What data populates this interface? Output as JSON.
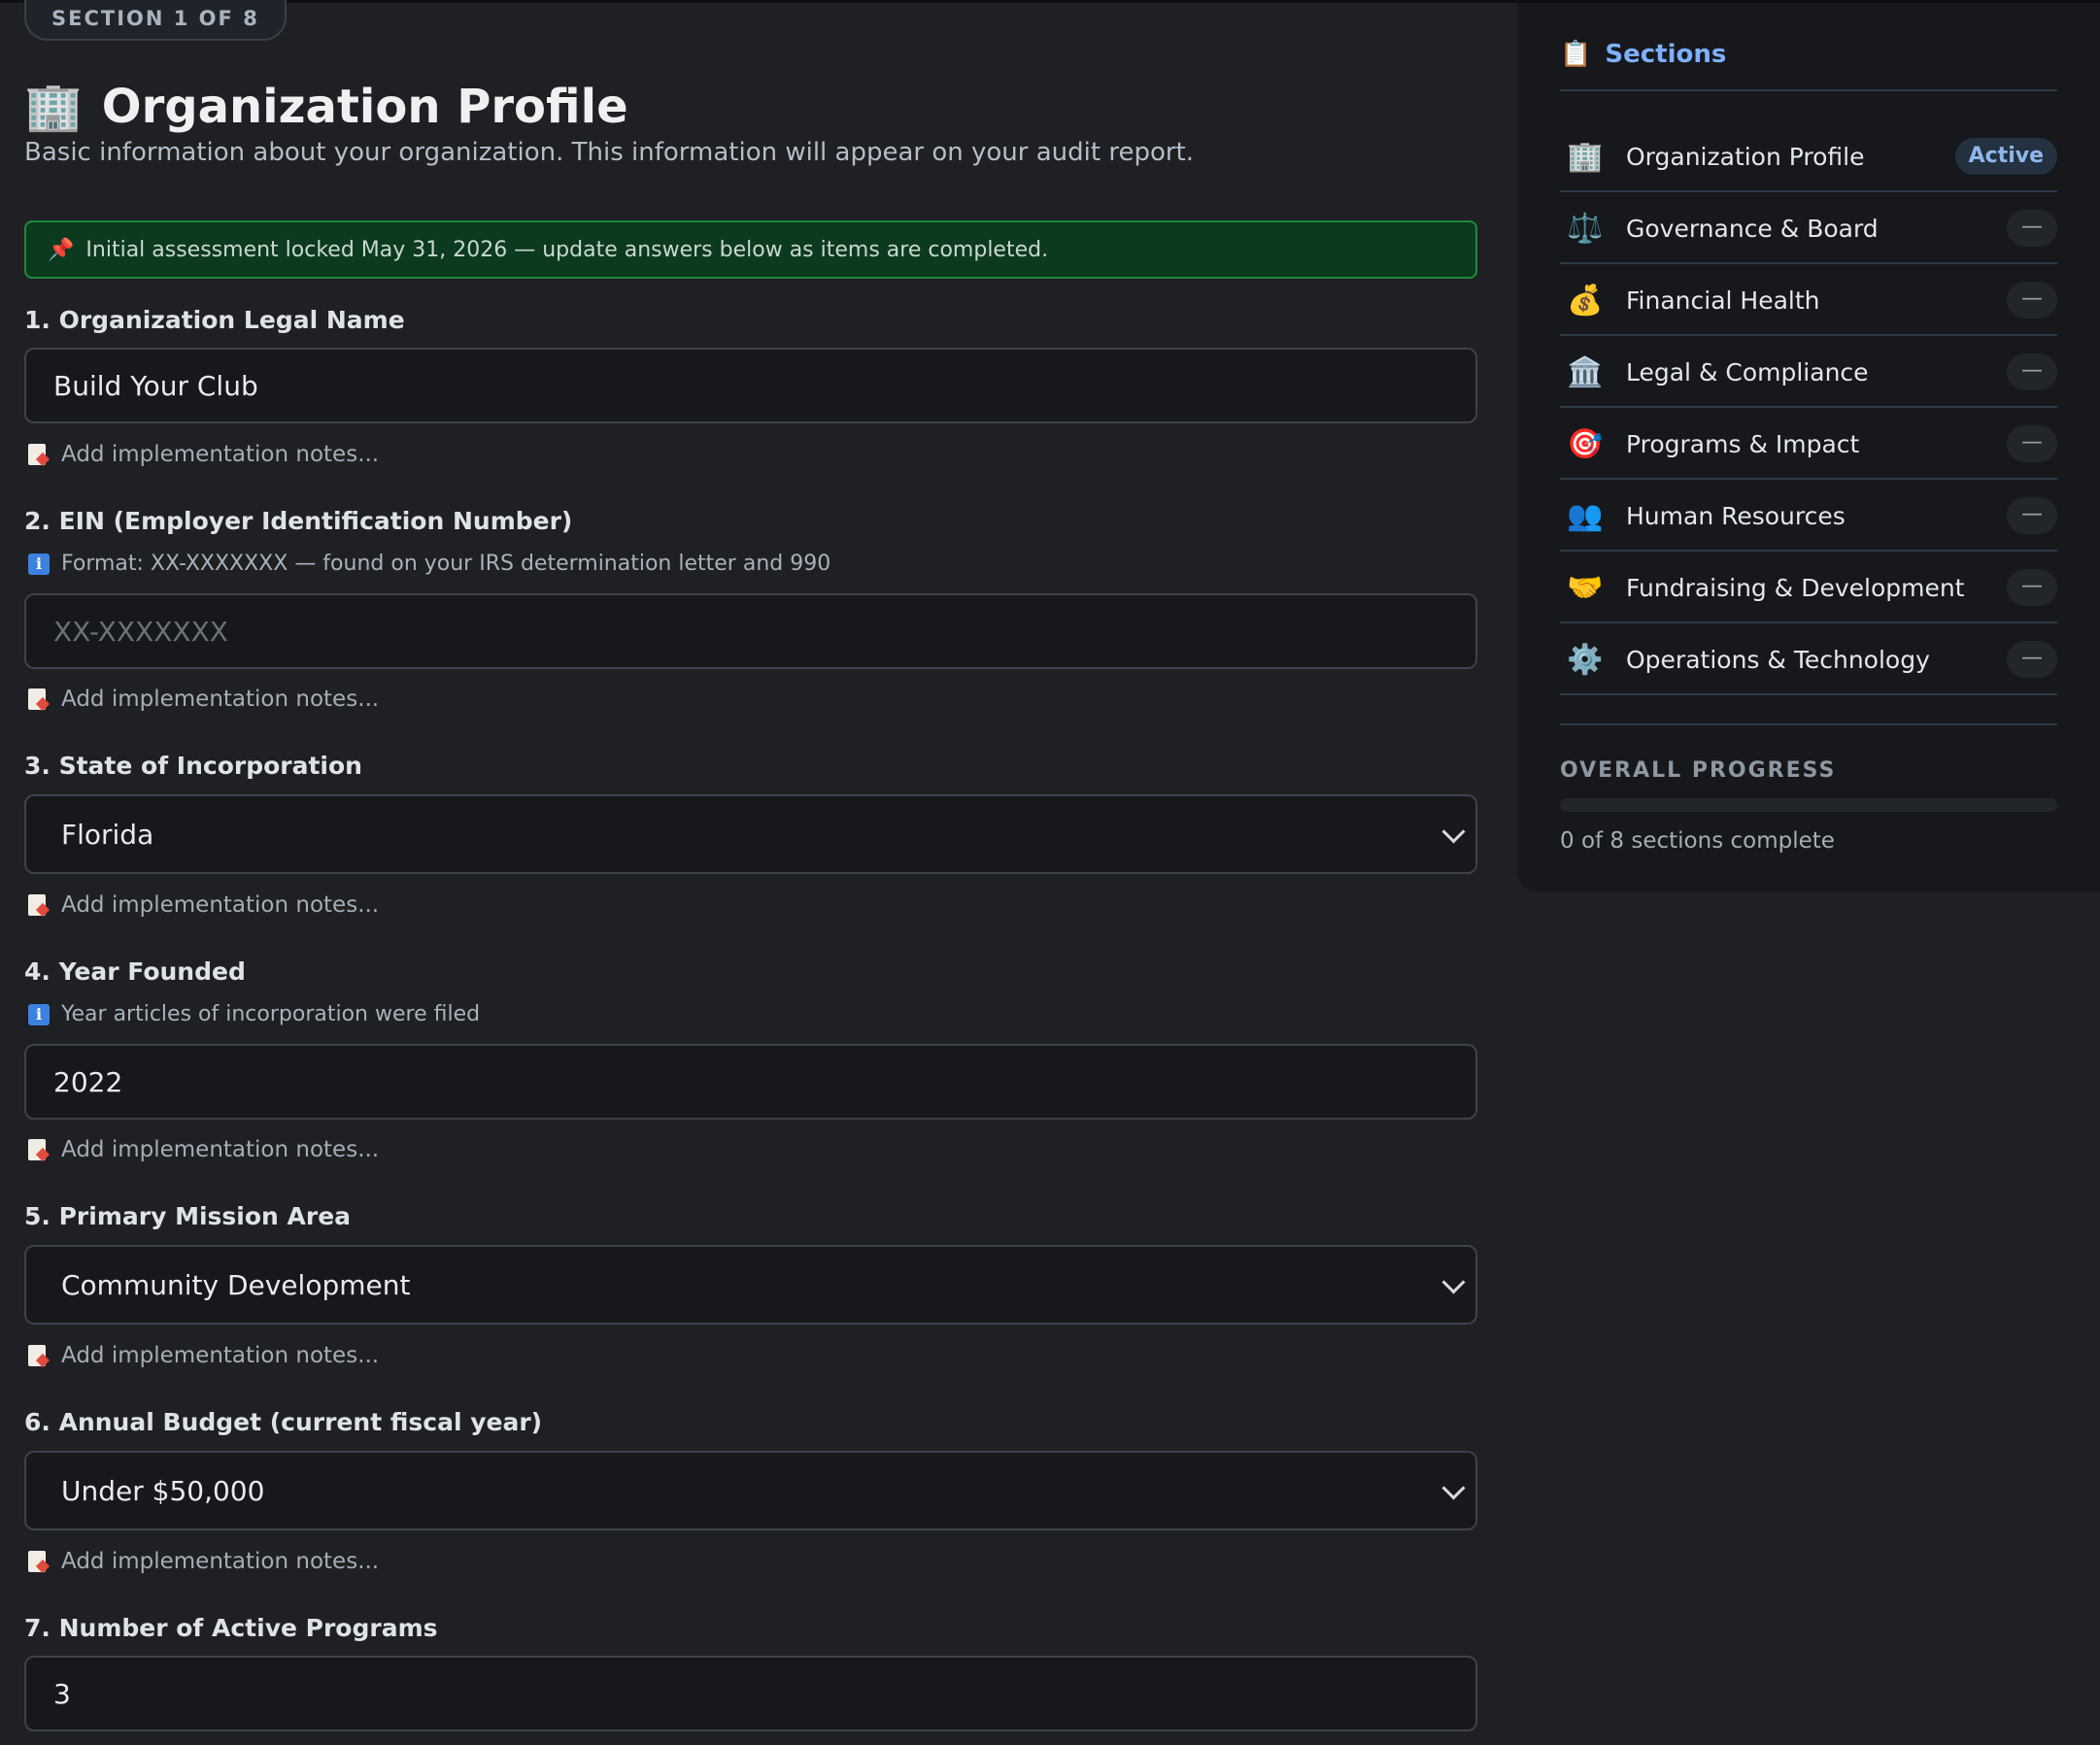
{
  "section_pill": "SECTION 1 OF 8",
  "page": {
    "title_icon": "🏢",
    "title": "Organization Profile",
    "subtitle": "Basic information about your organization. This information will appear on your audit report."
  },
  "banner": {
    "icon": "📌",
    "text": "Initial assessment locked May 31, 2026 — update answers below as items are completed."
  },
  "notes_label": "Add implementation notes...",
  "questions": [
    {
      "label": "1. Organization Legal Name",
      "value": "Build Your Club"
    },
    {
      "label": "2. EIN (Employer Identification Number)",
      "hint": "Format: XX-XXXXXXX — found on your IRS determination letter and 990",
      "placeholder": "XX-XXXXXXX"
    },
    {
      "label": "3. State of Incorporation",
      "value": "Florida"
    },
    {
      "label": "4. Year Founded",
      "hint": "Year articles of incorporation were filed",
      "value": "2022"
    },
    {
      "label": "5. Primary Mission Area",
      "value": "Community Development"
    },
    {
      "label": "6. Annual Budget (current fiscal year)",
      "value": "Under $50,000"
    },
    {
      "label": "7. Number of Active Programs",
      "value": "3"
    }
  ],
  "sidebar": {
    "icon": "📋",
    "title": "Sections",
    "items": [
      {
        "icon": "🏢",
        "label": "Organization Profile",
        "status": "Active"
      },
      {
        "icon": "⚖️",
        "label": "Governance & Board",
        "status": "—"
      },
      {
        "icon": "💰",
        "label": "Financial Health",
        "status": "—"
      },
      {
        "icon": "🏛️",
        "label": "Legal & Compliance",
        "status": "—"
      },
      {
        "icon": "🎯",
        "label": "Programs & Impact",
        "status": "—"
      },
      {
        "icon": "👥",
        "label": "Human Resources",
        "status": "—"
      },
      {
        "icon": "🤝",
        "label": "Fundraising & Development",
        "status": "—"
      },
      {
        "icon": "⚙️",
        "label": "Operations & Technology",
        "status": "—"
      }
    ],
    "progress_label": "OVERALL PROGRESS",
    "progress_fraction": 0,
    "progress_text": "0 of 8 sections complete"
  },
  "colors": {
    "accent": "#3b82e0",
    "banner_border": "#1f8a3b",
    "banner_bg": "#0c3a1f"
  }
}
